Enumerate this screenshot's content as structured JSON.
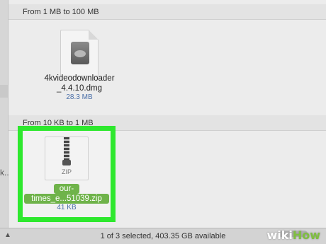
{
  "sections": [
    {
      "header": "From 1 MB to 100 MB"
    },
    {
      "header": "From 10 KB to 1 MB"
    }
  ],
  "files": [
    {
      "name_line1": "4kvideodownloader",
      "name_line2": "_4.4.10.dmg",
      "size": "28.3 MB",
      "icon": "dmg-disk-image-icon"
    },
    {
      "name_line1": "our-",
      "name_line2": "times_e...51039.zip",
      "size": "41 KB",
      "icon": "zip-archive-icon",
      "icon_label": "ZIP"
    }
  ],
  "sidebar": {
    "truncated_label": "k..."
  },
  "statusbar": {
    "text": "1 of 3 selected, 403.35 GB available"
  },
  "watermark": {
    "wiki": "wiki",
    "how": "How"
  },
  "colors": {
    "highlight": "#2ee82e",
    "selection": "#6fb34a",
    "size_text": "#4a6fa8"
  }
}
